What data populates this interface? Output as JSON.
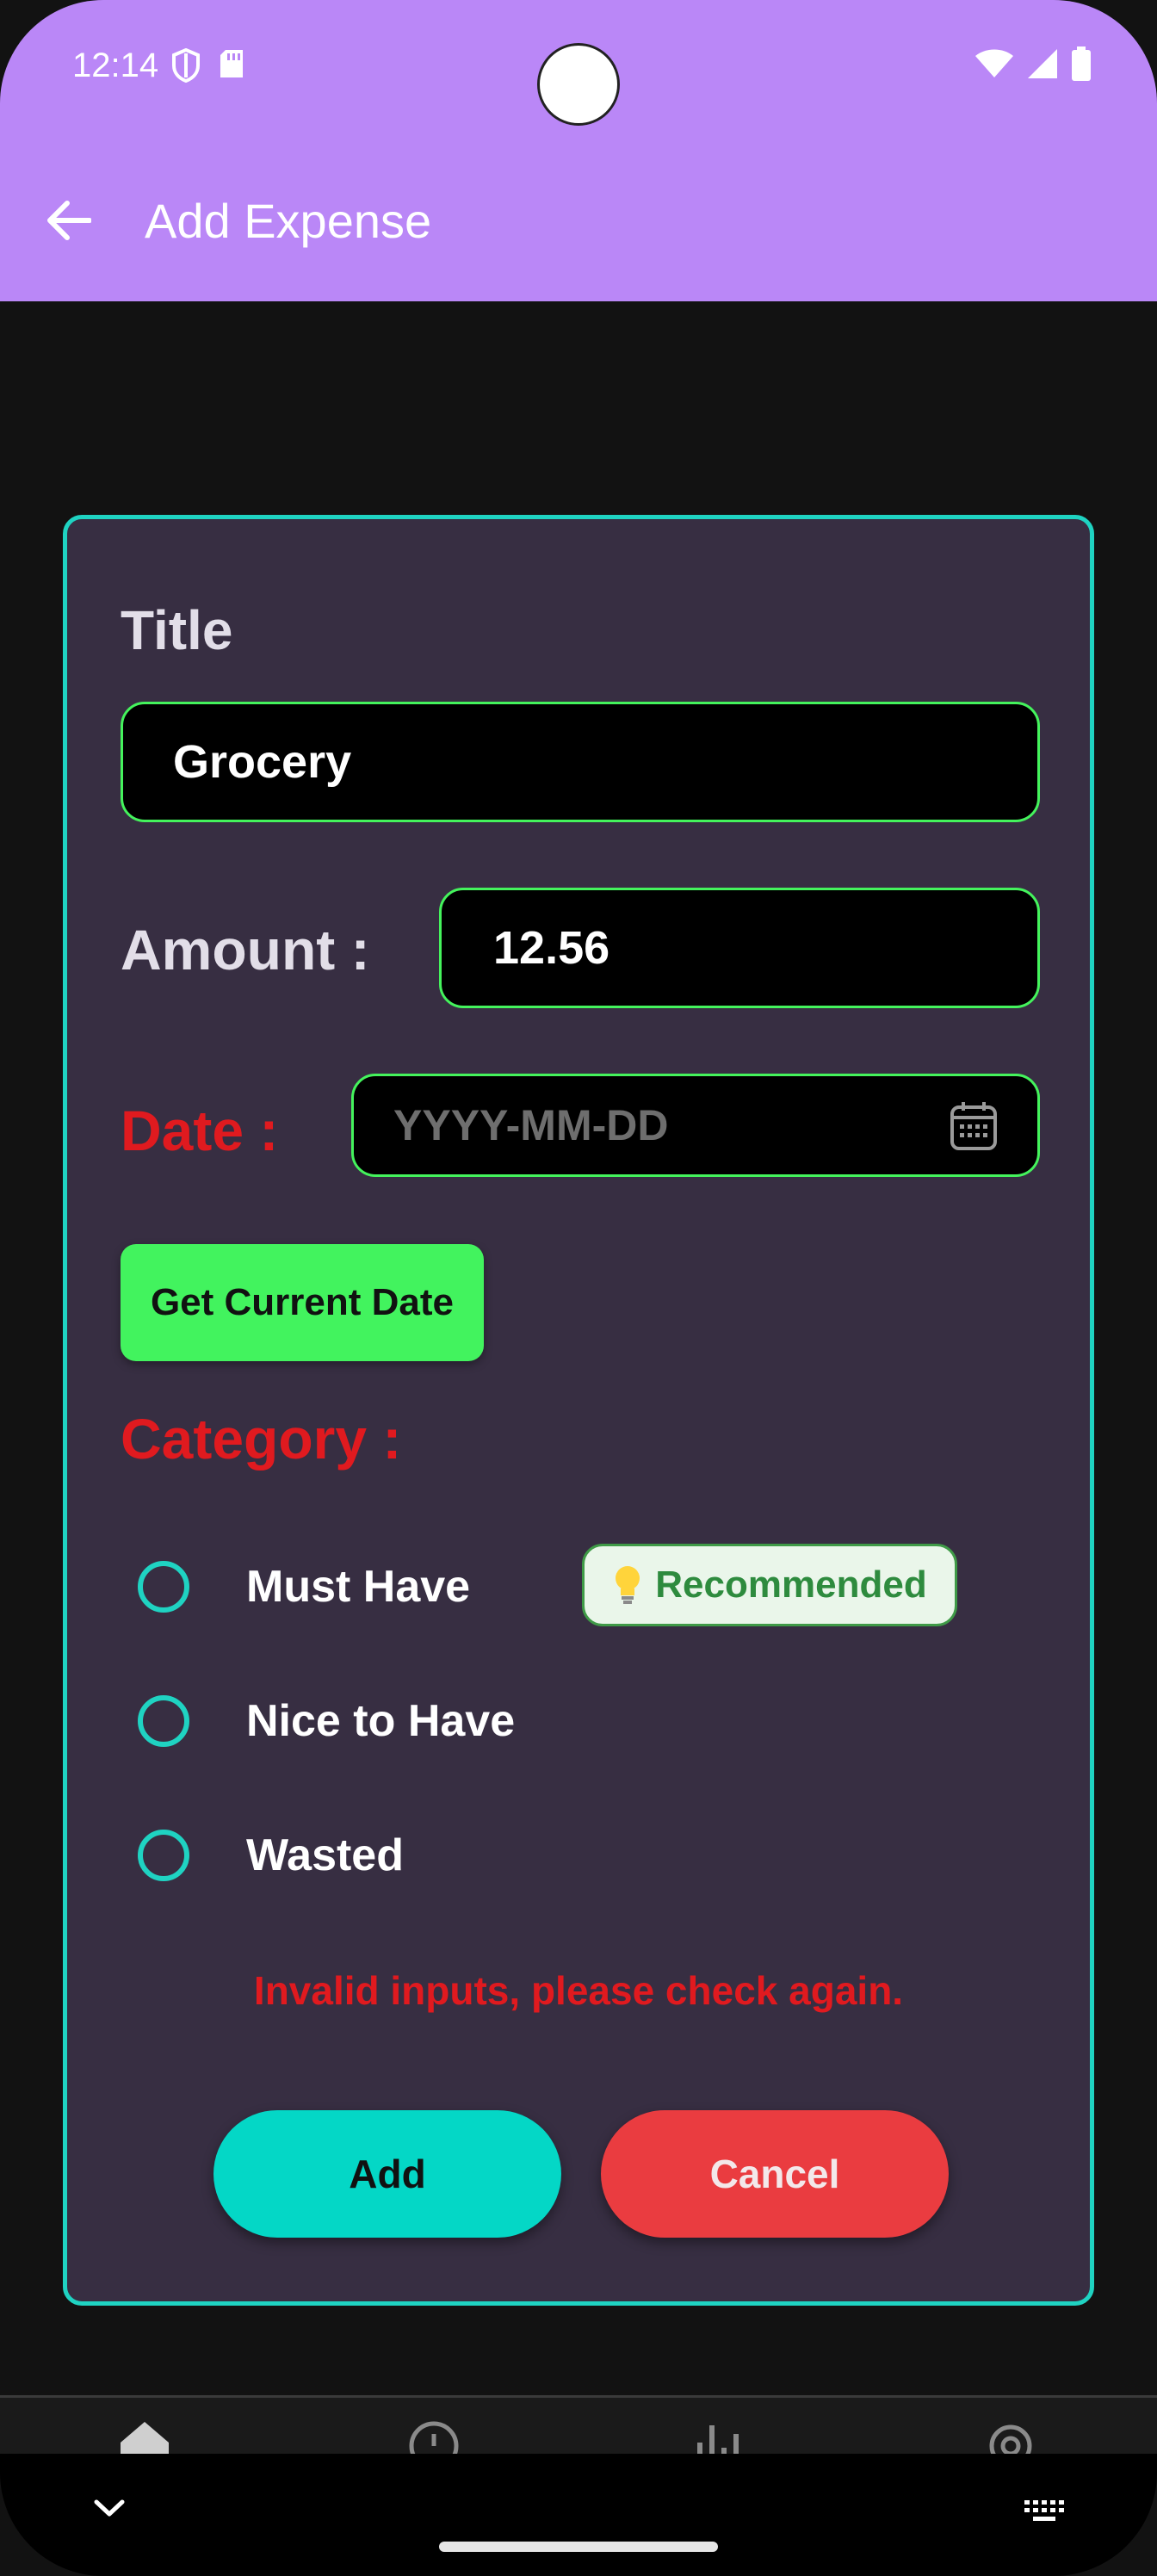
{
  "status_bar": {
    "time": "12:14"
  },
  "app_bar": {
    "title": "Add Expense"
  },
  "form": {
    "title_label": "Title",
    "title_value": "Grocery",
    "amount_label": "Amount :",
    "amount_value": "12.56",
    "date_label": "Date :",
    "date_placeholder": "YYYY-MM-DD",
    "get_date_button": "Get Current Date",
    "category_label": "Category :",
    "categories": [
      {
        "label": "Must Have",
        "selected": false
      },
      {
        "label": "Nice to Have",
        "selected": false
      },
      {
        "label": "Wasted",
        "selected": false
      }
    ],
    "recommended_badge": "Recommended",
    "error_message": "Invalid inputs, please check again.",
    "add_button": "Add",
    "cancel_button": "Cancel"
  },
  "colors": {
    "app_bar": "#BA87F7",
    "card_border": "#1FD3C2",
    "input_border": "#44F35C",
    "error": "#E01A1F",
    "add_button": "#04D7C6",
    "cancel_button": "#EA3C40"
  }
}
